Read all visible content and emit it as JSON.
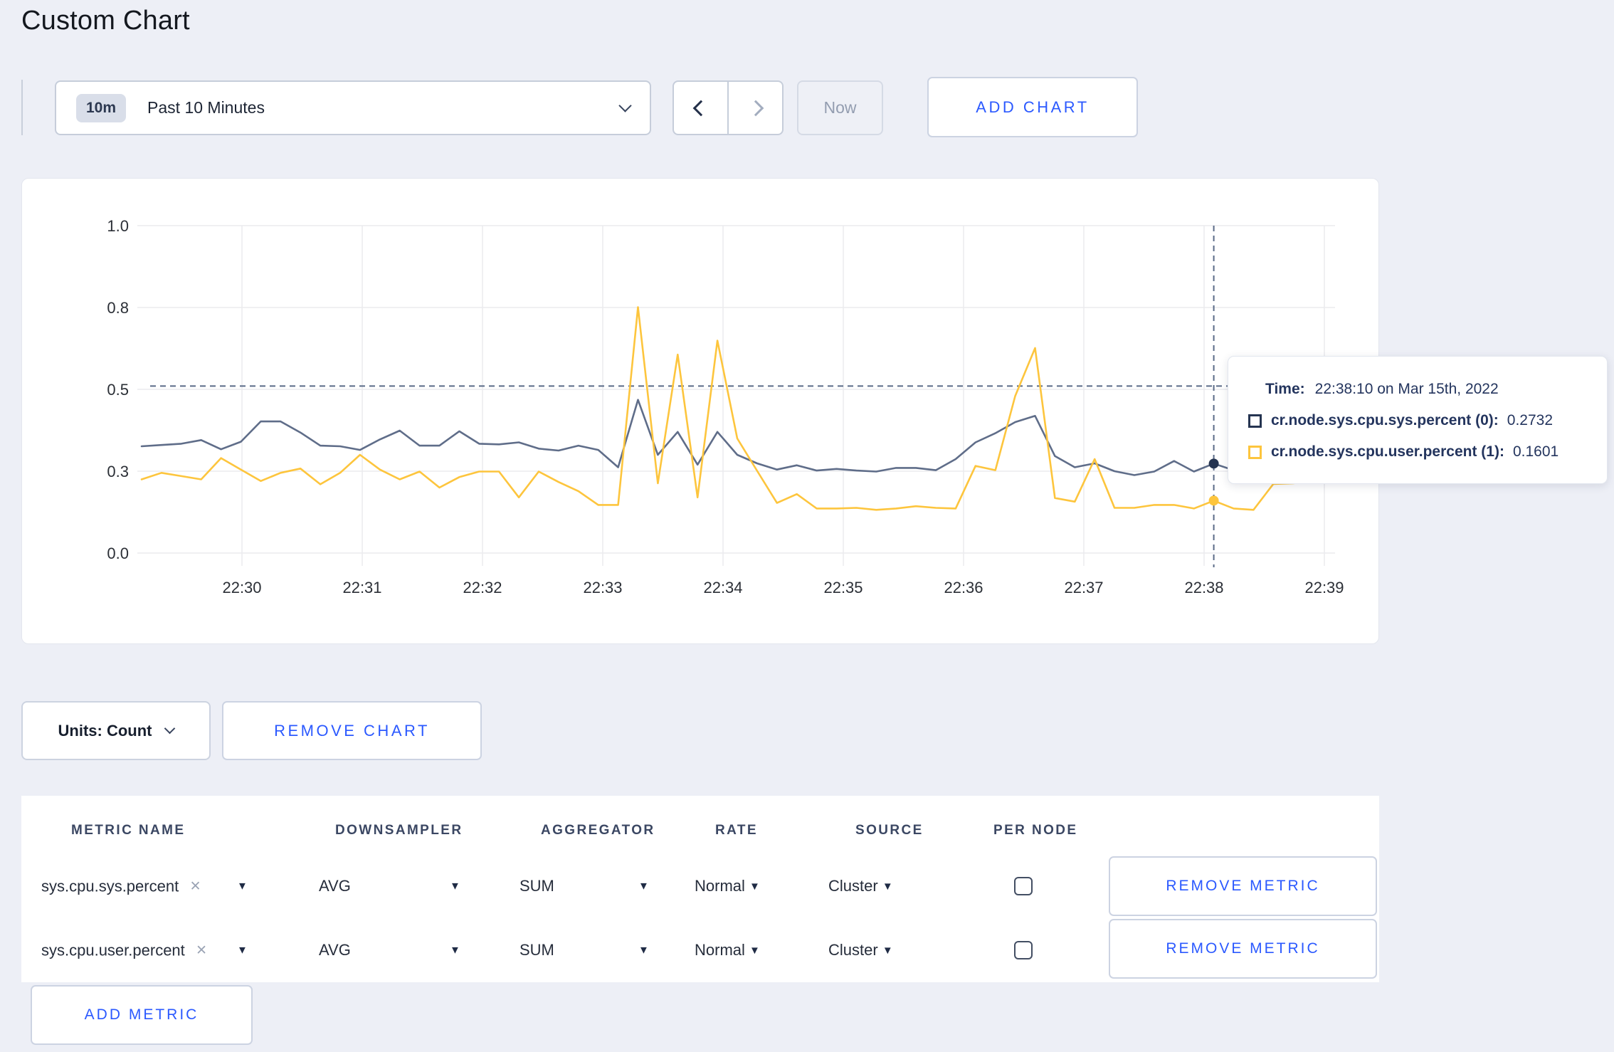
{
  "page": {
    "title": "Custom Chart",
    "background": "#edeff6",
    "accent_blue": "#2b59ff"
  },
  "toolbar": {
    "time_window_badge": "10m",
    "time_window_label": "Past 10 Minutes",
    "now_label": "Now",
    "add_chart_label": "ADD CHART"
  },
  "tooltip": {
    "time_label": "Time:",
    "time_value": "22:38:10 on Mar 15th, 2022",
    "rows": [
      {
        "name": "cr.node.sys.cpu.sys.percent (0):",
        "value": "0.2732",
        "swatch": "#253451"
      },
      {
        "name": "cr.node.sys.cpu.user.percent (1):",
        "value": "0.1601",
        "swatch": "#fdc53d"
      }
    ]
  },
  "units_button_label": "Units: Count",
  "remove_chart_label": "REMOVE CHART",
  "table": {
    "headers": [
      "METRIC NAME",
      "DOWNSAMPLER",
      "AGGREGATOR",
      "RATE",
      "SOURCE",
      "PER NODE"
    ],
    "rows": [
      {
        "metric": "sys.cpu.sys.percent",
        "downsampler": "AVG",
        "aggregator": "SUM",
        "rate": "Normal",
        "source": "Cluster",
        "per_node_checked": false,
        "remove_label": "REMOVE METRIC"
      },
      {
        "metric": "sys.cpu.user.percent",
        "downsampler": "AVG",
        "aggregator": "SUM",
        "rate": "Normal",
        "source": "Cluster",
        "per_node_checked": false,
        "remove_label": "REMOVE METRIC"
      }
    ]
  },
  "add_metric_label": "ADD METRIC",
  "chart_data": {
    "type": "line",
    "title": "",
    "x_start_label": "22:29:10",
    "x_interval_seconds": 10,
    "x_tick_labels": [
      "22:30",
      "22:31",
      "22:32",
      "22:33",
      "22:34",
      "22:35",
      "22:36",
      "22:37",
      "22:38",
      "22:39"
    ],
    "y_tick_labels": [
      "1.0",
      "0.8",
      "0.5",
      "0.3",
      "0.0"
    ],
    "y_range": [
      0.0,
      1.0
    ],
    "grid": true,
    "legend_position": "tooltip",
    "series": [
      {
        "name": "cr.node.sys.cpu.sys.percent",
        "color": "#5f6d89",
        "swatch": "#253451",
        "values": [
          0.326,
          0.33,
          0.334,
          0.345,
          0.317,
          0.34,
          0.402,
          0.402,
          0.368,
          0.328,
          0.326,
          0.315,
          0.347,
          0.374,
          0.328,
          0.328,
          0.372,
          0.334,
          0.332,
          0.338,
          0.319,
          0.313,
          0.328,
          0.315,
          0.262,
          0.468,
          0.3,
          0.37,
          0.27,
          0.37,
          0.3,
          0.274,
          0.255,
          0.268,
          0.252,
          0.257,
          0.252,
          0.249,
          0.26,
          0.26,
          0.253,
          0.287,
          0.338,
          0.366,
          0.4,
          0.419,
          0.296,
          0.262,
          0.274,
          0.25,
          0.238,
          0.249,
          0.281,
          0.249,
          0.2732,
          0.253,
          0.262,
          0.3,
          0.31,
          0.295,
          0.3
        ]
      },
      {
        "name": "cr.node.sys.cpu.user.percent",
        "color": "#fdc53d",
        "swatch": "#fdc53d",
        "values": [
          0.225,
          0.245,
          0.235,
          0.225,
          0.29,
          0.255,
          0.22,
          0.245,
          0.258,
          0.21,
          0.245,
          0.3,
          0.255,
          0.225,
          0.249,
          0.2,
          0.232,
          0.249,
          0.249,
          0.17,
          0.249,
          0.217,
          0.189,
          0.147,
          0.147,
          0.751,
          0.213,
          0.606,
          0.17,
          0.649,
          0.35,
          0.251,
          0.153,
          0.18,
          0.136,
          0.136,
          0.138,
          0.132,
          0.136,
          0.143,
          0.138,
          0.136,
          0.266,
          0.253,
          0.48,
          0.626,
          0.168,
          0.157,
          0.287,
          0.138,
          0.138,
          0.147,
          0.147,
          0.136,
          0.1601,
          0.136,
          0.132,
          0.211,
          0.213,
          0.22,
          0.275
        ]
      }
    ],
    "hover": {
      "index": 54,
      "time": "22:38:10",
      "crosshair_value": 0.51
    }
  }
}
